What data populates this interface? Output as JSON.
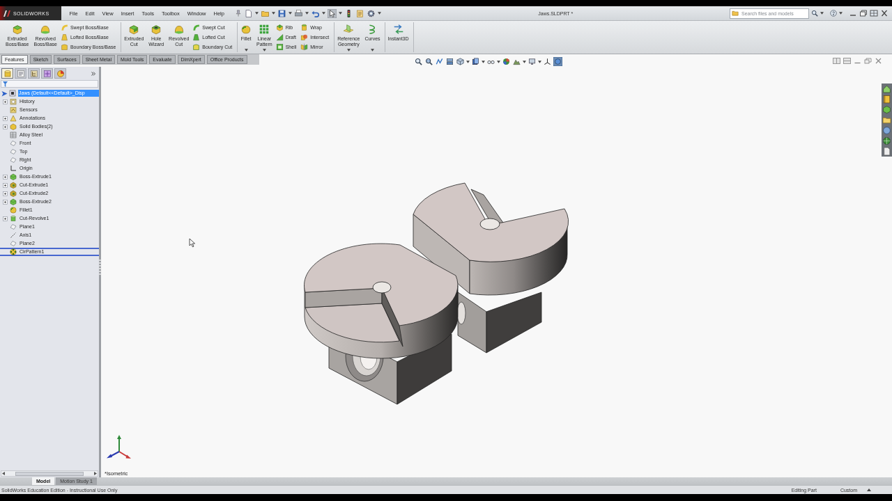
{
  "title_bar": {
    "logo": "SOLIDWORKS",
    "menu": [
      "File",
      "Edit",
      "View",
      "Insert",
      "Tools",
      "Toolbox",
      "Window",
      "Help"
    ],
    "quick_access": [
      {
        "kind": "new",
        "menu": true,
        "on": false
      },
      {
        "kind": "open",
        "menu": true,
        "on": false
      },
      {
        "kind": "save",
        "menu": true,
        "on": false
      },
      {
        "kind": "print",
        "menu": true,
        "on": false
      },
      {
        "kind": "undo",
        "menu": true,
        "on": false
      },
      {
        "kind": "select",
        "menu": true,
        "on": true
      },
      {
        "kind": "rebuild",
        "menu": false,
        "on": false
      },
      {
        "kind": "properties",
        "menu": false,
        "on": false
      },
      {
        "kind": "options",
        "menu": true,
        "on": false
      }
    ],
    "document_title": "Jaws.SLDPRT *",
    "search": {
      "placeholder": "Search files and models"
    }
  },
  "command_manager": [
    {
      "large": [
        {
          "label": "Extruded Boss/Base",
          "menu": false
        },
        {
          "label": "Revolved Boss/Base",
          "menu": false
        }
      ],
      "stacks": [
        [
          "Swept Boss/Base",
          "Lofted Boss/Base",
          "Boundary Boss/Base"
        ]
      ]
    },
    {
      "large": [
        {
          "label": "Extruded Cut",
          "menu": false
        },
        {
          "label": "Hole Wizard",
          "menu": false
        },
        {
          "label": "Revolved Cut",
          "menu": false
        }
      ],
      "stacks": [
        [
          "Swept Cut",
          "Lofted Cut",
          "Boundary Cut"
        ]
      ]
    },
    {
      "large": [
        {
          "label": "Fillet",
          "menu": true
        },
        {
          "label": "Linear Pattern",
          "menu": true
        }
      ],
      "stacks": [
        [
          "Rib",
          "Draft",
          "Shell"
        ],
        [
          "Wrap",
          "Intersect",
          "Mirror"
        ]
      ]
    },
    {
      "large": [
        {
          "label": "Reference Geometry",
          "menu": true
        },
        {
          "label": "Curves",
          "menu": true
        }
      ]
    },
    {
      "large": [
        {
          "label": "Instant3D",
          "menu": false
        }
      ]
    }
  ],
  "tabs": [
    {
      "label": "Features",
      "selected": true
    },
    {
      "label": "Sketch",
      "selected": false
    },
    {
      "label": "Surfaces",
      "selected": false
    },
    {
      "label": "Sheet Metal",
      "selected": false
    },
    {
      "label": "Mold Tools",
      "selected": false
    },
    {
      "label": "Evaluate",
      "selected": false
    },
    {
      "label": "DimXpert",
      "selected": false
    },
    {
      "label": "Office Products",
      "selected": false
    }
  ],
  "view_toolbar": [
    {
      "kind": "zoomfit",
      "menu": false,
      "on": false
    },
    {
      "kind": "zoomarea",
      "menu": false,
      "on": false
    },
    {
      "kind": "previous",
      "menu": false,
      "on": false
    },
    {
      "kind": "section",
      "menu": false,
      "on": false
    },
    {
      "kind": "orientation",
      "menu": true,
      "on": false
    },
    {
      "kind": "display",
      "menu": true,
      "on": false
    },
    {
      "kind": "hide",
      "menu": true,
      "on": false
    },
    {
      "kind": "appearance",
      "menu": false,
      "on": false
    },
    {
      "kind": "scene",
      "menu": true,
      "on": false
    },
    {
      "kind": "settings",
      "menu": true,
      "on": false
    },
    {
      "kind": "triad",
      "menu": false,
      "on": false
    },
    {
      "kind": "realview",
      "menu": false,
      "on": true
    }
  ],
  "feature_tree": {
    "panel_tabs": [
      {
        "selected": true
      },
      {
        "selected": false
      },
      {
        "selected": false
      },
      {
        "selected": false
      },
      {
        "selected": false
      }
    ],
    "root": {
      "label": "Jaws (Default<<Default>_Disp",
      "selected": true,
      "children": [
        {
          "label": "History",
          "kind": "history",
          "expandable": true,
          "selected": false,
          "focused": false
        },
        {
          "label": "Sensors",
          "kind": "sensors",
          "expandable": false,
          "selected": false,
          "focused": false
        },
        {
          "label": "Annotations",
          "kind": "annotations",
          "expandable": true,
          "selected": false,
          "focused": false
        },
        {
          "label": "Solid Bodies(2)",
          "kind": "bodies",
          "expandable": true,
          "selected": false,
          "focused": false
        },
        {
          "label": "Alloy Steel",
          "kind": "material",
          "expandable": false,
          "selected": false,
          "focused": false
        },
        {
          "label": "Front",
          "kind": "plane",
          "expandable": false,
          "selected": false,
          "focused": false
        },
        {
          "label": "Top",
          "kind": "plane",
          "expandable": false,
          "selected": false,
          "focused": false
        },
        {
          "label": "Right",
          "kind": "plane",
          "expandable": false,
          "selected": false,
          "focused": false
        },
        {
          "label": "Origin",
          "kind": "origin",
          "expandable": false,
          "selected": false,
          "focused": false
        },
        {
          "label": "Boss-Extrude1",
          "kind": "extrude",
          "expandable": true,
          "selected": false,
          "focused": false
        },
        {
          "label": "Cut-Extrude1",
          "kind": "cut",
          "expandable": true,
          "selected": false,
          "focused": false
        },
        {
          "label": "Cut-Extrude2",
          "kind": "cut",
          "expandable": true,
          "selected": false,
          "focused": false
        },
        {
          "label": "Boss-Extrude2",
          "kind": "extrude",
          "expandable": true,
          "selected": false,
          "focused": false
        },
        {
          "label": "Fillet1",
          "kind": "fillet",
          "expandable": false,
          "selected": false,
          "focused": false
        },
        {
          "label": "Cut-Revolve1",
          "kind": "revolve",
          "expandable": true,
          "selected": false,
          "focused": false
        },
        {
          "label": "Plane1",
          "kind": "plane",
          "expandable": false,
          "selected": false,
          "focused": false
        },
        {
          "label": "Axis1",
          "kind": "axis",
          "expandable": false,
          "selected": false,
          "focused": false
        },
        {
          "label": "Plane2",
          "kind": "plane",
          "expandable": false,
          "selected": false,
          "focused": false
        },
        {
          "label": "CirPattern1",
          "kind": "pattern",
          "expandable": false,
          "selected": false,
          "focused": true
        }
      ]
    }
  },
  "viewport": {
    "view_name": "*Isometric"
  },
  "bottom_tabs": [
    {
      "label": "Model",
      "selected": true
    },
    {
      "label": "Motion Study 1",
      "selected": false
    }
  ],
  "status_bar": {
    "message": "SolidWorks Education Edition - Instructional Use Only",
    "mode": "Editing Part",
    "units": "Custom"
  }
}
